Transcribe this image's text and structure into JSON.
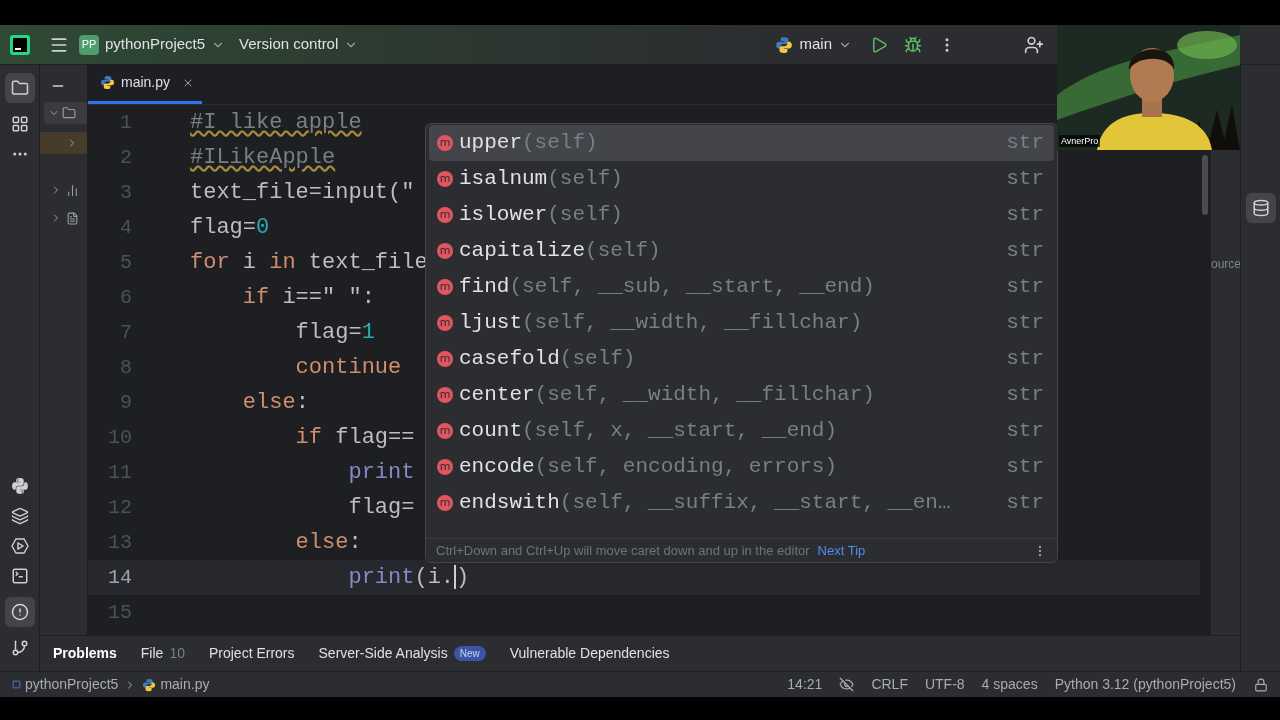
{
  "title_bar": {
    "project_badge": "PP",
    "project": "pythonProject5",
    "vcs": "Version control",
    "run_config": "main"
  },
  "webcam": {
    "kind": "picture",
    "name_tag": "AvnerPro"
  },
  "editor": {
    "tabs": [
      {
        "label": "main.py",
        "selected": true
      }
    ],
    "lines": [
      {
        "number": "1",
        "current": false,
        "tokens": [
          {
            "text": "#I like apple",
            "kind": "comment"
          }
        ]
      },
      {
        "number": "2",
        "current": false,
        "tokens": [
          {
            "text": "#ILikeApple",
            "kind": "comment"
          }
        ]
      },
      {
        "number": "3",
        "current": false,
        "tokens": [
          {
            "text": "text_file=input(\"",
            "kind": "plain"
          }
        ]
      },
      {
        "number": "4",
        "current": false,
        "tokens": [
          {
            "text": "flag=",
            "kind": "plain"
          },
          {
            "text": "0",
            "kind": "number"
          }
        ]
      },
      {
        "number": "5",
        "current": false,
        "tokens": [
          {
            "text": "for",
            "kind": "keyword"
          },
          {
            "text": " i ",
            "kind": "plain"
          },
          {
            "text": "in",
            "kind": "keyword"
          },
          {
            "text": " text_file",
            "kind": "plain"
          }
        ]
      },
      {
        "number": "6",
        "current": false,
        "tokens": [
          {
            "text": "    if",
            "kind": "keyword"
          },
          {
            "text": " i==\" \":",
            "kind": "plain"
          }
        ]
      },
      {
        "number": "7",
        "current": false,
        "tokens": [
          {
            "text": "        flag=",
            "kind": "plain"
          },
          {
            "text": "1",
            "kind": "number"
          }
        ]
      },
      {
        "number": "8",
        "current": false,
        "tokens": [
          {
            "text": "        continue",
            "kind": "keyword"
          }
        ]
      },
      {
        "number": "9",
        "current": false,
        "tokens": [
          {
            "text": "    else",
            "kind": "keyword"
          },
          {
            "text": ":",
            "kind": "plain"
          }
        ]
      },
      {
        "number": "10",
        "current": false,
        "tokens": [
          {
            "text": "        if",
            "kind": "keyword"
          },
          {
            "text": " flag==",
            "kind": "plain"
          }
        ]
      },
      {
        "number": "11",
        "current": false,
        "tokens": [
          {
            "text": "            print",
            "kind": "builtin"
          }
        ]
      },
      {
        "number": "12",
        "current": false,
        "tokens": [
          {
            "text": "            flag=",
            "kind": "plain"
          }
        ]
      },
      {
        "number": "13",
        "current": false,
        "tokens": [
          {
            "text": "        else",
            "kind": "keyword"
          },
          {
            "text": ":",
            "kind": "plain"
          }
        ]
      },
      {
        "number": "14",
        "current": true,
        "tokens": [
          {
            "text": "            print",
            "kind": "builtin"
          },
          {
            "text": "(i.",
            "kind": "plain"
          },
          {
            "kind": "caret"
          },
          {
            "text": ")",
            "kind": "plain"
          }
        ]
      },
      {
        "number": "15",
        "current": false
      }
    ]
  },
  "completion": {
    "items": [
      {
        "icon": "m",
        "name": "upper",
        "params": "(self)",
        "type": "str",
        "selected": true
      },
      {
        "icon": "m",
        "name": "isalnum",
        "params": "(self)",
        "type": "str",
        "selected": false
      },
      {
        "icon": "m",
        "name": "islower",
        "params": "(self)",
        "type": "str",
        "selected": false
      },
      {
        "icon": "m",
        "name": "capitalize",
        "params": "(self)",
        "type": "str",
        "selected": false
      },
      {
        "icon": "m",
        "name": "find",
        "params": "(self, __sub, __start, __end)",
        "type": "str",
        "selected": false
      },
      {
        "icon": "m",
        "name": "ljust",
        "params": "(self, __width, __fillchar)",
        "type": "str",
        "selected": false
      },
      {
        "icon": "m",
        "name": "casefold",
        "params": "(self)",
        "type": "str",
        "selected": false
      },
      {
        "icon": "m",
        "name": "center",
        "params": "(self, __width, __fillchar)",
        "type": "str",
        "selected": false
      },
      {
        "icon": "m",
        "name": "count",
        "params": "(self, x, __start, __end)",
        "type": "str",
        "selected": false
      },
      {
        "icon": "m",
        "name": "encode",
        "params": "(self, encoding, errors)",
        "type": "str",
        "selected": false
      },
      {
        "icon": "m",
        "name": "endswith",
        "params": "(self, __suffix, __start, __en…",
        "type": "str",
        "selected": false
      }
    ],
    "tip": "Ctrl+Down and Ctrl+Up will move caret down and up in the editor",
    "next_tip": "Next Tip"
  },
  "right_panel": {
    "text": "ource"
  },
  "bottom_tabs": [
    {
      "label": "Problems",
      "selected": true
    },
    {
      "label": "File",
      "count": "10",
      "selected": false
    },
    {
      "label": "Project Errors",
      "selected": false
    },
    {
      "label": "Server-Side Analysis",
      "badge": "New",
      "selected": false
    },
    {
      "label": "Vulnerable Dependencies",
      "selected": false
    }
  ],
  "status_bar": {
    "breadcrumbs": [
      "pythonProject5",
      "main.py"
    ],
    "position": "14:21",
    "line_separator": "CRLF",
    "encoding": "UTF-8",
    "indent": "4 spaces",
    "interpreter": "Python 3.12 (pythonProject5)"
  }
}
